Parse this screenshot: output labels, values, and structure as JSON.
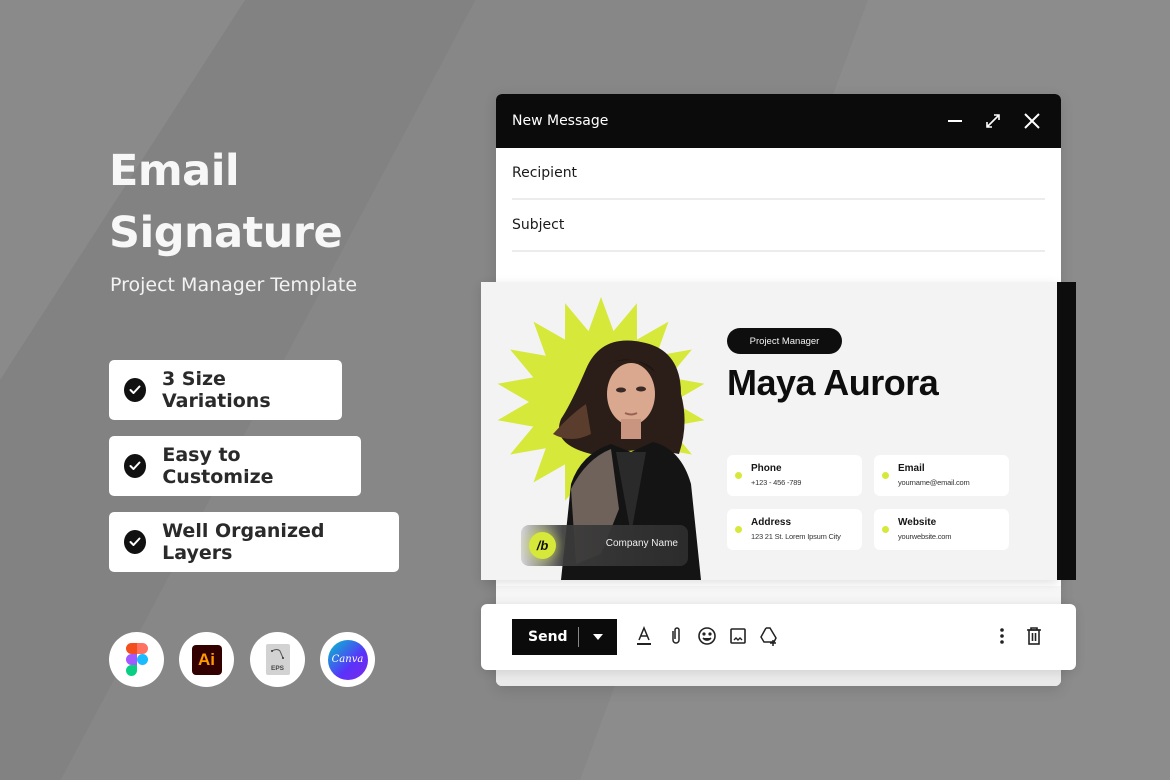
{
  "hero": {
    "title_line1": "Email",
    "title_line2": "Signature",
    "subtitle": "Project Manager Template"
  },
  "features": [
    {
      "label": "3 Size Variations",
      "icon": "check-circle-icon"
    },
    {
      "label": "Easy to Customize",
      "icon": "check-circle-icon"
    },
    {
      "label": "Well Organized Layers",
      "icon": "check-circle-icon"
    }
  ],
  "tools": [
    {
      "name": "Figma",
      "icon": "figma-icon"
    },
    {
      "name": "Ai",
      "icon": "illustrator-icon"
    },
    {
      "name": "EPS",
      "icon": "eps-file-icon"
    },
    {
      "name": "Canva",
      "icon": "canva-icon"
    }
  ],
  "window": {
    "title": "New Message",
    "controls": [
      "minimize-icon",
      "expand-icon",
      "close-icon"
    ],
    "fields": {
      "recipient_label": "Recipient",
      "recipient_value": "",
      "subject_label": "Subject",
      "subject_value": ""
    }
  },
  "signature": {
    "role": "Project Manager",
    "name": "Maya Aurora",
    "company": {
      "name": "Company Name",
      "logo_text": "/b"
    },
    "contacts": [
      {
        "label": "Phone",
        "value": "+123 - 456 -789"
      },
      {
        "label": "Email",
        "value": "yourname@email.com"
      },
      {
        "label": "Address",
        "value": "123 21 St. Lorem Ipsum City"
      },
      {
        "label": "Website",
        "value": "yourwebsite.com"
      }
    ],
    "accent_color": "#d6e83a"
  },
  "toolbar": {
    "send_label": "Send",
    "icons": [
      "text-format-icon",
      "attachment-icon",
      "emoji-icon",
      "insert-image-icon",
      "drive-icon",
      "more-options-icon",
      "trash-icon"
    ]
  }
}
